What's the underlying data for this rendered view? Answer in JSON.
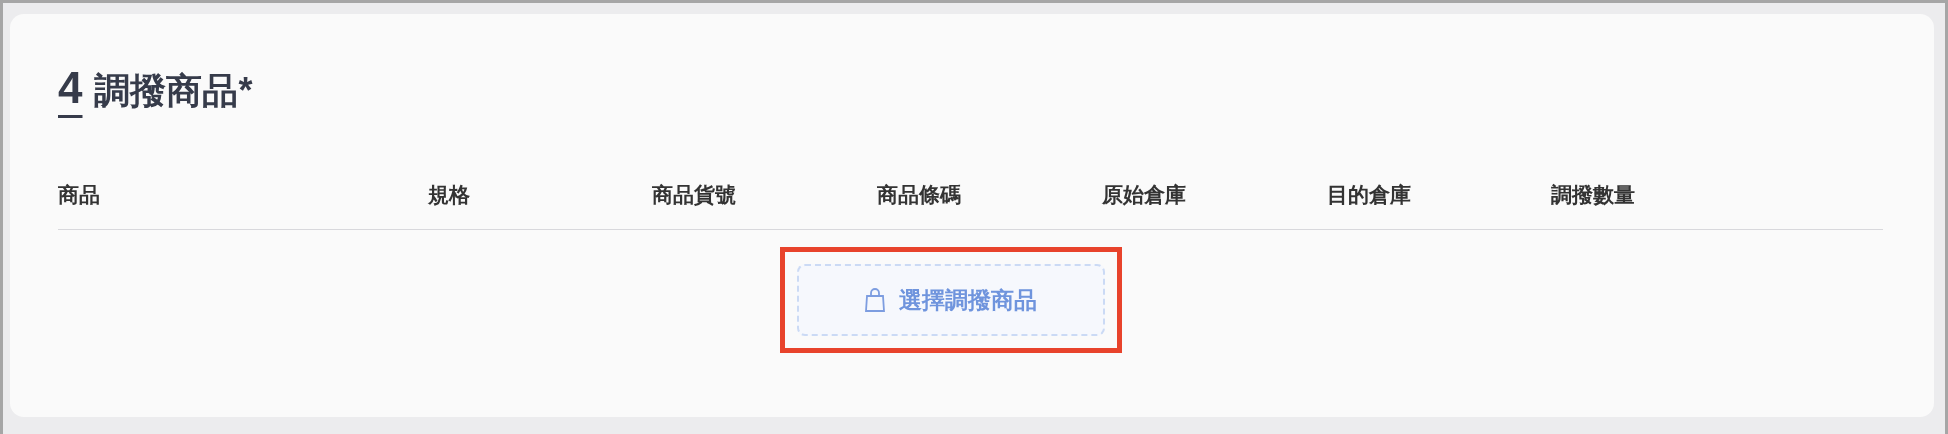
{
  "section": {
    "step": "4",
    "title": "調撥商品*",
    "table": {
      "columns": [
        "商品",
        "規格",
        "商品貨號",
        "商品條碼",
        "原始倉庫",
        "目的倉庫",
        "調撥數量"
      ]
    },
    "select_button": {
      "label": "選擇調撥商品",
      "highlighted": true
    }
  }
}
